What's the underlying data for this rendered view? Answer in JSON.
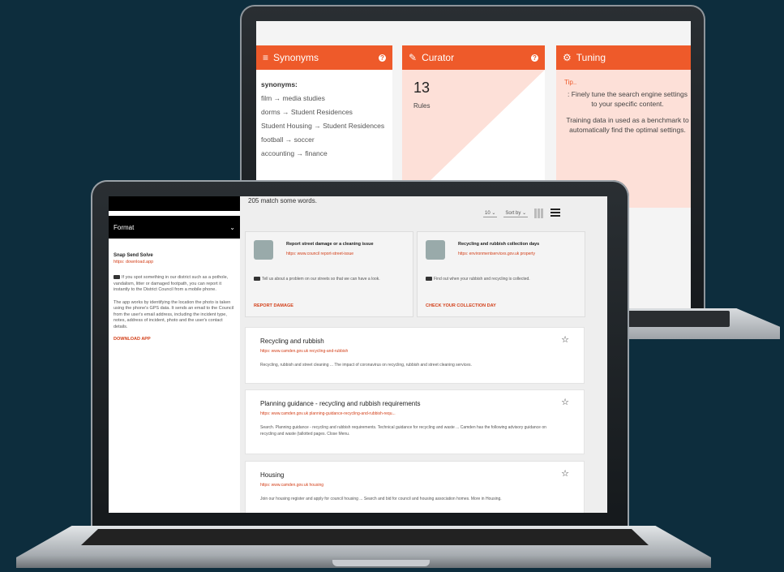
{
  "back": {
    "synonyms": {
      "title": "Synonyms",
      "heading": "synonyms:",
      "rows": [
        "film → media studies",
        "dorms → Student Residences",
        "Student Housing → Student Residences",
        "football → soccer",
        "accounting → finance"
      ]
    },
    "curator": {
      "title": "Curator",
      "count": "13",
      "label": "Rules"
    },
    "tuning": {
      "title": "Tuning",
      "tip": "Tip..",
      "line1": ": Finely tune the search engine settings to your specific content.",
      "line2": "Training data in used as a benchmark to automatically find the optimal settings."
    }
  },
  "front": {
    "sidebar": {
      "format_label": "Format",
      "snap_title": "Snap Send Solve",
      "snap_link": "https:   download.app",
      "para1": "If you spot something in our district such as a pothole, vandalism, litter or damaged footpath, you can report it instantly to the District Council from a mobile phone.",
      "para2": "The app works by identifying the location the photo is taken using the phone's GPS data. It sends an email to the Council from the user's email address, including the incident type, notes, address of incident, photo and the user's contact details.",
      "download": "DOWNLOAD APP"
    },
    "results_count": "205 match some words.",
    "per_page": "10",
    "sort_by": "Sort by",
    "featured": [
      {
        "title": "Report street damage or a cleaning issue",
        "url": "https:   www.council   report-street-issue",
        "desc": "Tell us about a problem on our streets so that we can have a look.",
        "cta": "REPORT DAMAGE"
      },
      {
        "title": "Recycling and rubbish collection days",
        "url": "https:   environmentservices.gov.uk   property",
        "desc": "Find out when your rubbish and recycling is collected.",
        "cta": "CHECK YOUR COLLECTION DAY"
      }
    ],
    "results": [
      {
        "title": "Recycling and rubbish",
        "url": "https:   www.camden.gov.uk   recycling-and-rubbish",
        "desc": "Recycling, rubbish and street cleaning ... The impact of coronavirus on recycling, rubbish and street cleaning services."
      },
      {
        "title": "Planning guidance - recycling and rubbish requirements",
        "url": "https:   www.camden.gov.uk   planning-guidance-recycling-and-rubbish-requ...",
        "desc": "Search. Planning guidance - recycling and rubbish requirements. Technical guidance for recycling and waste ... Camden has the following advisory guidance on recycling and waste (tallotted pages. Close Menu."
      },
      {
        "title": "Housing",
        "url": "https:   www.camden.gov.uk   housing",
        "desc": "Join our housing register and apply for council housing ... Search and bid for council and housing association homes. More in Housing."
      }
    ]
  }
}
